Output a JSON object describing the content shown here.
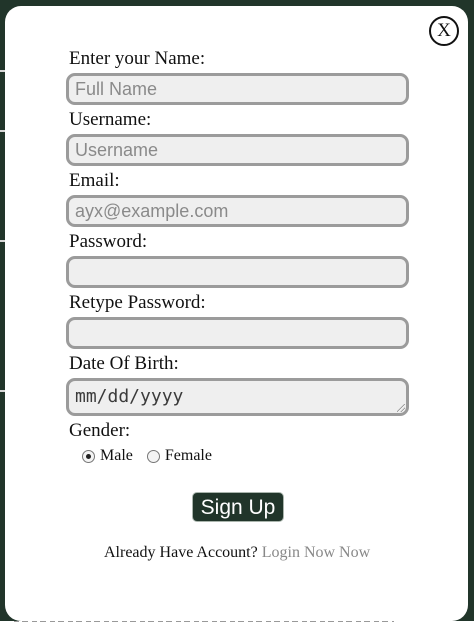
{
  "modal": {
    "close_label": "X",
    "labels": {
      "name": "Enter your Name:",
      "username": "Username:",
      "email": "Email:",
      "password": "Password:",
      "retype": "Retype Password:",
      "dob": "Date Of Birth:",
      "gender": "Gender:"
    },
    "placeholders": {
      "name": "Full Name",
      "username": "Username",
      "email": "ayx@example.com",
      "dob": "mm/dd/yyyy"
    },
    "gender_options": [
      "Male",
      "Female"
    ],
    "gender_selected": "Male",
    "signup_label": "Sign Up",
    "footer_prefix": "Already Have Account?",
    "footer_link": "Login Now Now"
  },
  "colors": {
    "brand_dark": "#21352a",
    "link_grey": "#888888"
  }
}
